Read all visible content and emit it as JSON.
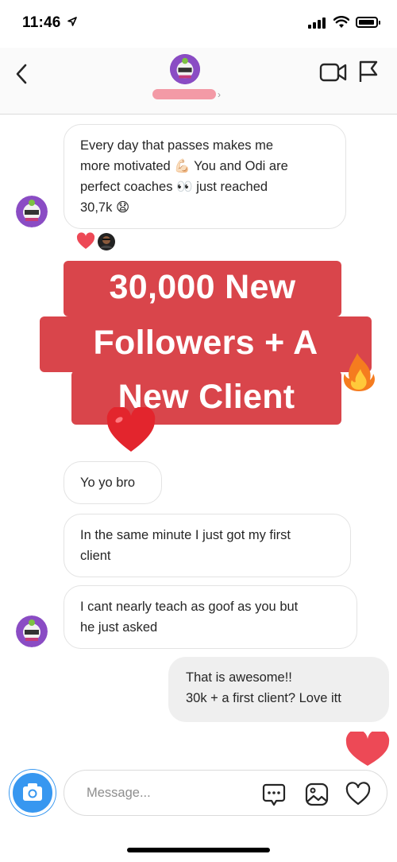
{
  "status_bar": {
    "time": "11:46"
  },
  "header": {
    "icons": [
      "back-icon",
      "video-call-icon",
      "flag-icon"
    ]
  },
  "messages": {
    "m1": {
      "lines": [
        "Every day that passes makes me",
        "more motivated 💪🏻 You and Odi are",
        "perfect coaches 👀 just reached",
        "30,7k 😧"
      ]
    },
    "m2": {
      "text": "Yo yo bro"
    },
    "m3": {
      "lines": [
        "In the same minute I just got my first",
        "client"
      ]
    },
    "m4": {
      "lines": [
        "I cant nearly teach as goof as you but",
        "he just asked"
      ]
    },
    "m5": {
      "lines": [
        "That is awesome!!",
        "30k + a first client? Love itt"
      ]
    }
  },
  "overlay": {
    "lines": [
      "30,000 New",
      "Followers + A",
      "New Client"
    ]
  },
  "composer": {
    "placeholder": "Message...",
    "icons": [
      "camera-icon",
      "chat-bubble-icon",
      "gallery-icon",
      "heart-icon"
    ]
  },
  "colors": {
    "banner": "#d9454b",
    "camera_button": "#3797f0",
    "outgoing_bubble": "#efefef",
    "heart": "#ed4956"
  }
}
